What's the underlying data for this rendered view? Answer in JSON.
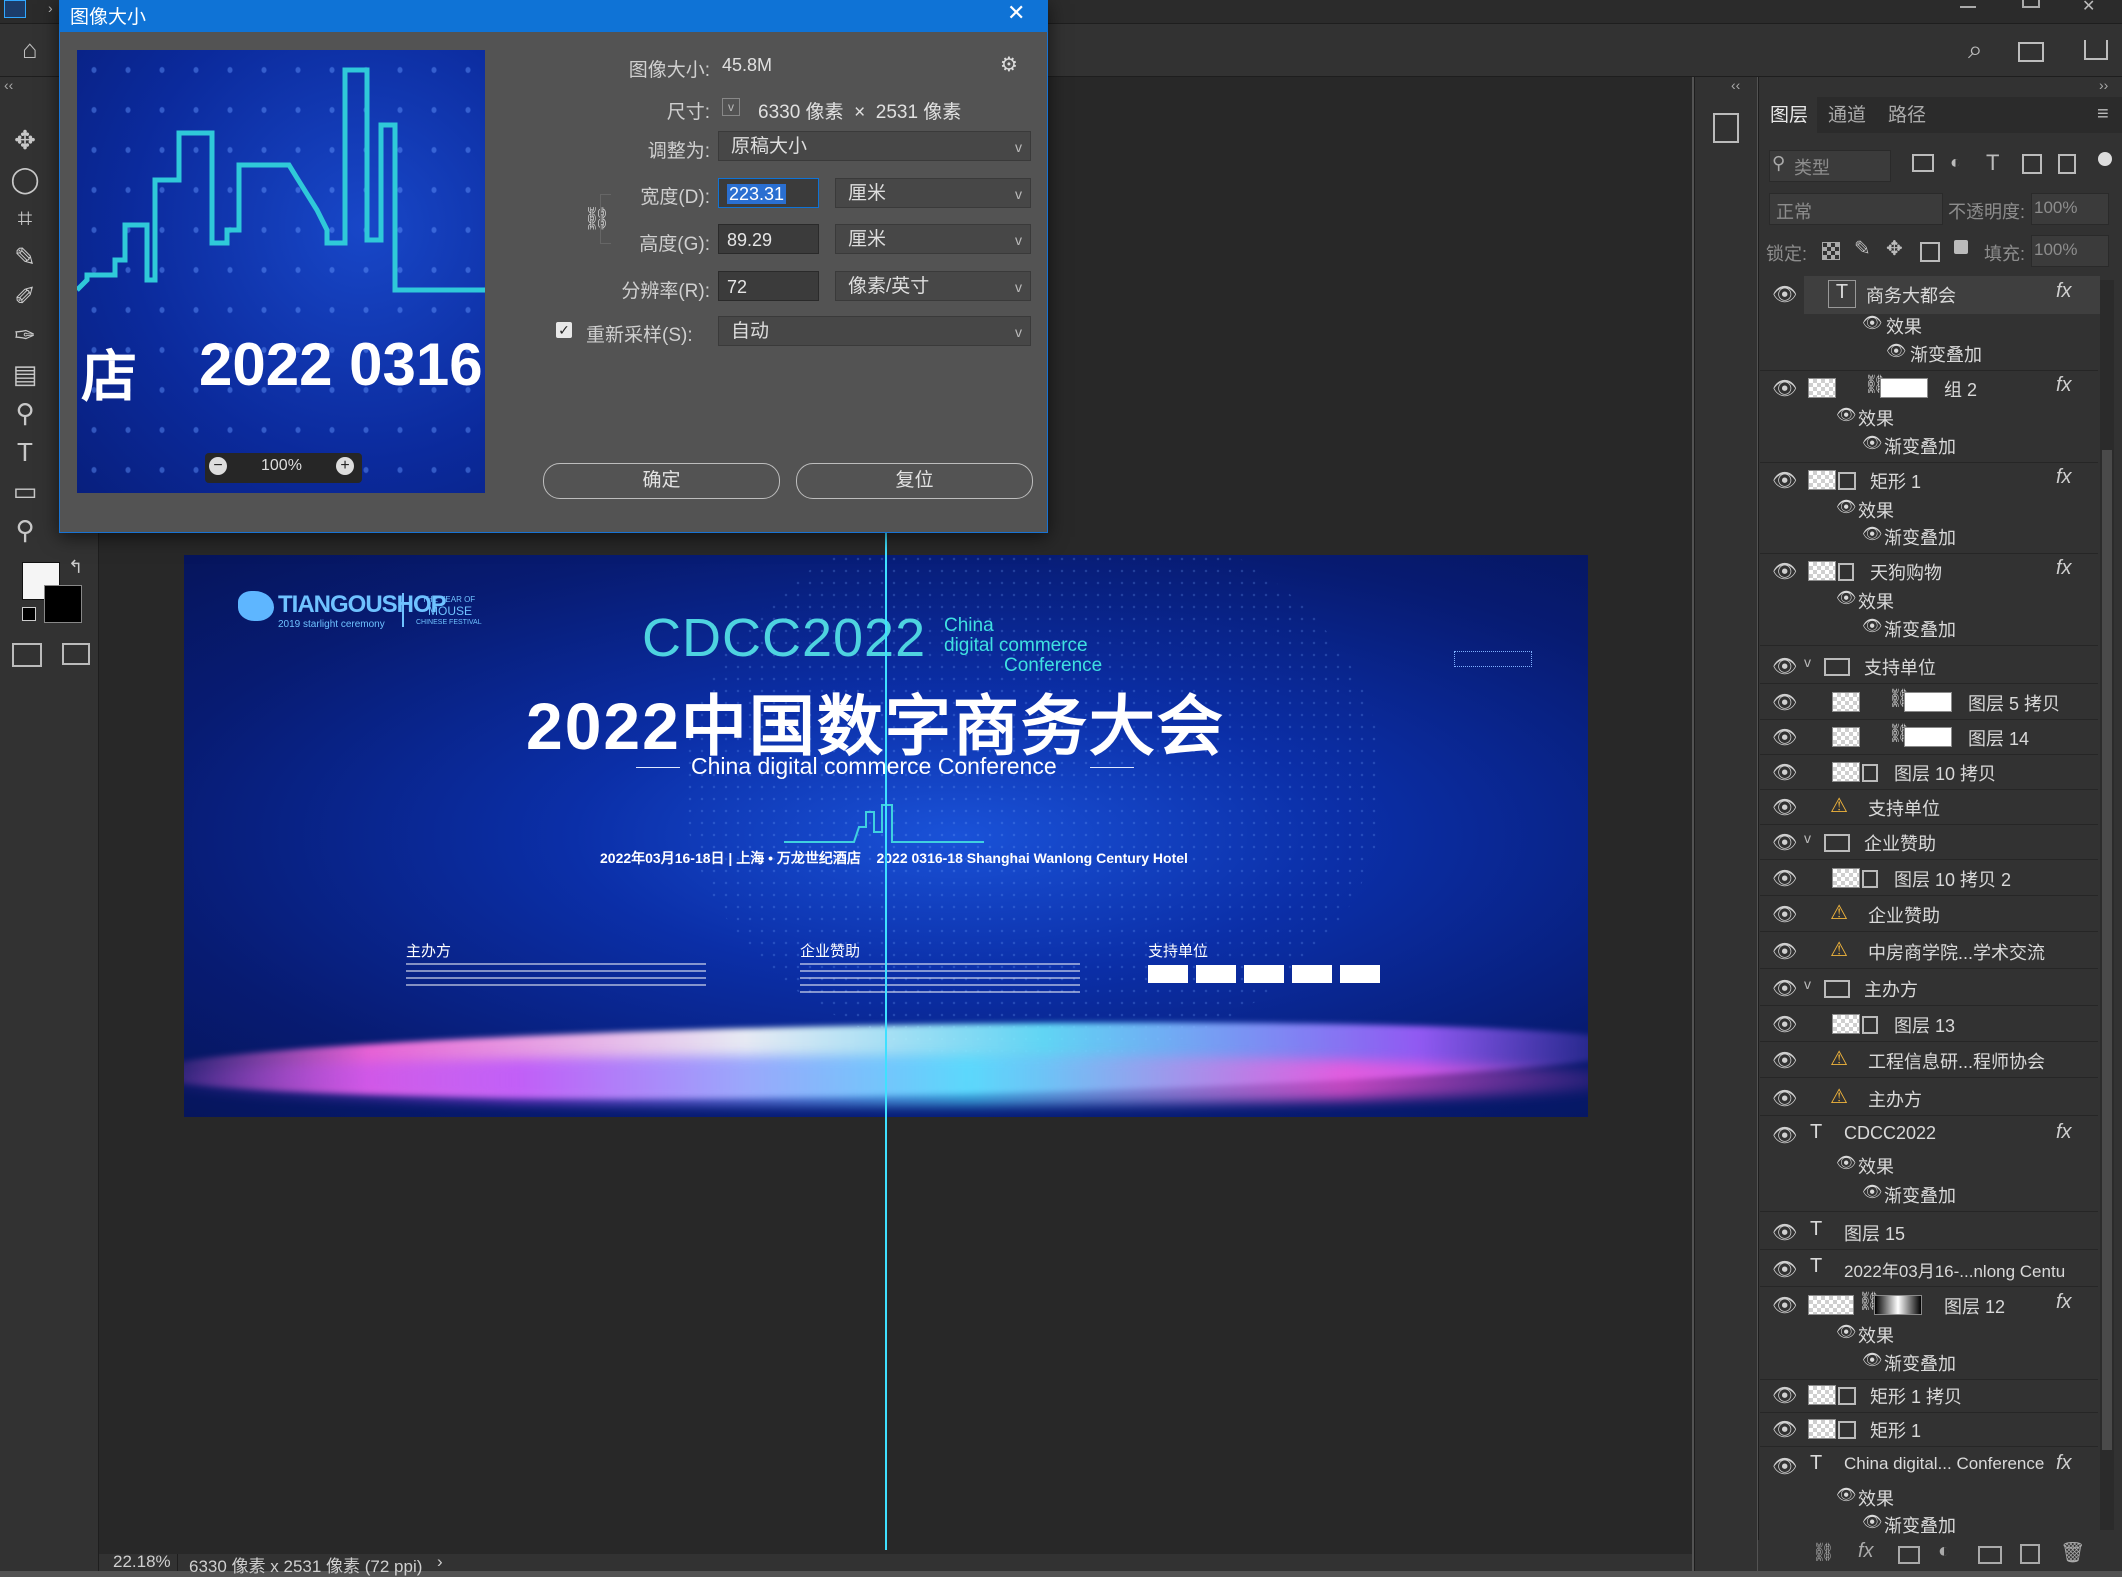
{
  "dialog": {
    "title": "图像大小",
    "close": "✕",
    "image_size_label": "图像大小:",
    "image_size_value": "45.8M",
    "dimensions_label": "尺寸:",
    "dimensions_value": "6330 像素  ×  2531 像素",
    "fit_to_label": "调整为:",
    "fit_to_value": "原稿大小",
    "width_label": "宽度(D):",
    "width_value": "223.31",
    "width_unit": "厘米",
    "height_label": "高度(G):",
    "height_value": "89.29",
    "height_unit": "厘米",
    "resolution_label": "分辨率(R):",
    "resolution_value": "72",
    "resolution_unit": "像素/英寸",
    "resample_label": "重新采样(S):",
    "resample_value": "自动",
    "resample_checked": true,
    "ok_label": "确定",
    "reset_label": "复位",
    "preview_zoom": "100%",
    "preview_text_left": "店",
    "preview_text_right": "2022 0316"
  },
  "canvas": {
    "brand": "TIANGOUSHOP",
    "brand_sub": "2019 starlight ceremony",
    "mouse_tag_1": "THE YEAR OF",
    "mouse_tag_2": "MOUSE",
    "mouse_tag_3": "CHINESE FESTIVAL",
    "cdcc": "CDCC2022",
    "china_1": "China",
    "china_2": "digital commerce",
    "china_3": "Conference",
    "main_title": "2022中国数字商务大会",
    "sub_title": "China digital commerce Conference",
    "date_line": "2022年03月16-18日 | 上海 • 万龙世纪酒店    2022 0316-18 Shanghai Wanlong Century Hotel",
    "section_1": "主办方",
    "section_2": "企业赞助",
    "section_3": "支持单位"
  },
  "status": {
    "zoom": "22.18%",
    "doc_info": "6330 像素 x 2531 像素 (72 ppi)",
    "arrow": "›"
  },
  "layers_panel": {
    "tabs": [
      "图层",
      "通道",
      "路径"
    ],
    "search_placeholder": "类型",
    "blend_mode": "正常",
    "opacity_label": "不透明度:",
    "opacity_value": "100%",
    "lock_label": "锁定:",
    "fill_label": "填充:",
    "fill_value": "100%",
    "layers": [
      {
        "name": "商务大都会",
        "fx": "fx"
      },
      {
        "name": "效果"
      },
      {
        "name": "渐变叠加"
      },
      {
        "name": "组 2",
        "fx": "fx"
      },
      {
        "name": "效果"
      },
      {
        "name": "渐变叠加"
      },
      {
        "name": "矩形 1",
        "fx": "fx"
      },
      {
        "name": "效果"
      },
      {
        "name": "渐变叠加"
      },
      {
        "name": "天狗购物",
        "fx": "fx"
      },
      {
        "name": "效果"
      },
      {
        "name": "渐变叠加"
      },
      {
        "name": "支持单位"
      },
      {
        "name": "图层 5 拷贝"
      },
      {
        "name": "图层 14"
      },
      {
        "name": "图层 10 拷贝"
      },
      {
        "name": "支持单位"
      },
      {
        "name": "企业赞助"
      },
      {
        "name": "图层 10 拷贝 2"
      },
      {
        "name": "企业赞助"
      },
      {
        "name": "中房商学院...学术交流"
      },
      {
        "name": "主办方"
      },
      {
        "name": "图层 13"
      },
      {
        "name": "工程信息研...程师协会"
      },
      {
        "name": "主办方"
      },
      {
        "name": "CDCC2022",
        "fx": "fx"
      },
      {
        "name": "效果"
      },
      {
        "name": "渐变叠加"
      },
      {
        "name": "图层 15"
      },
      {
        "name": "2022年03月16-...nlong Centu"
      },
      {
        "name": "图层 12",
        "fx": "fx"
      },
      {
        "name": "效果"
      },
      {
        "name": "渐变叠加"
      },
      {
        "name": "矩形 1 拷贝"
      },
      {
        "name": "矩形 1"
      },
      {
        "name": "China digital... Conference",
        "fx": "fx"
      },
      {
        "name": "效果"
      },
      {
        "name": "渐变叠加"
      }
    ]
  }
}
